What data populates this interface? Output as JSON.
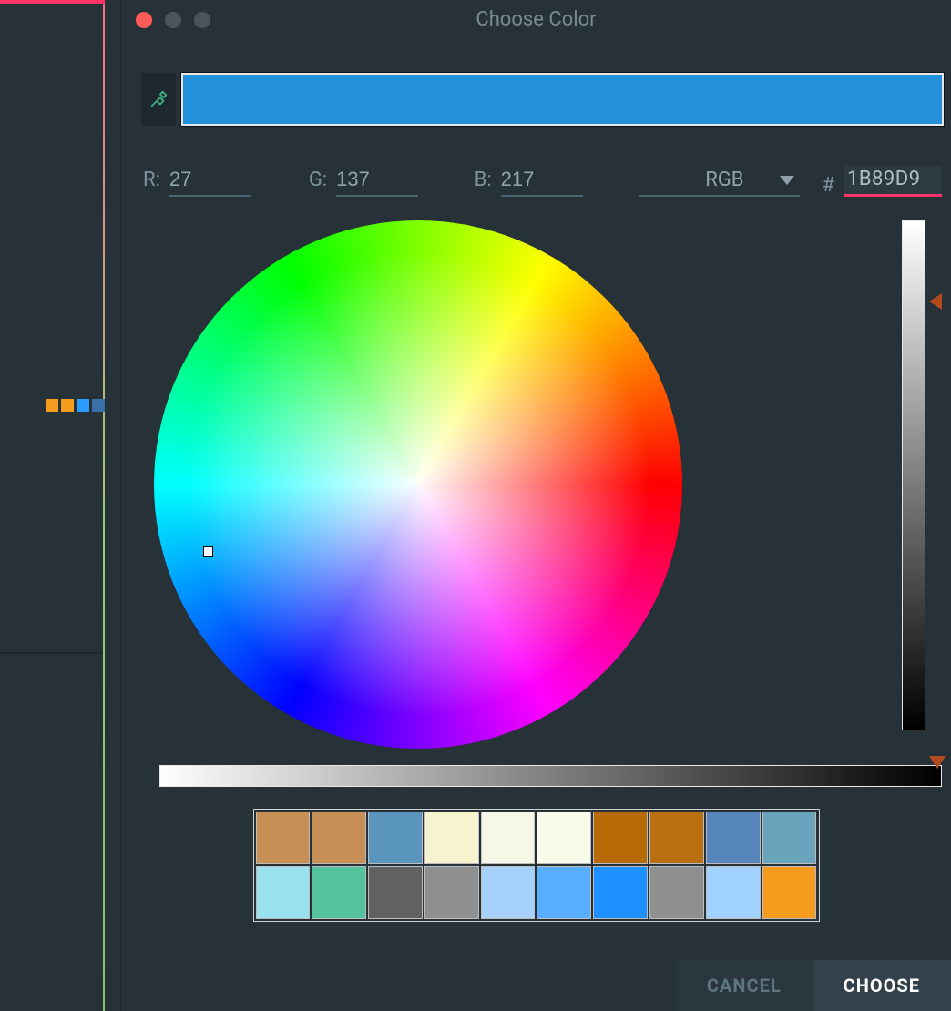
{
  "dialog": {
    "title": "Choose Color",
    "preview_color": "#2491dd",
    "channels": {
      "r_label": "R:",
      "r_value": "27",
      "g_label": "G:",
      "g_value": "137",
      "b_label": "B:",
      "b_value": "217"
    },
    "mode": "RGB",
    "hash": "#",
    "hex": "1B89D9",
    "value_slider_position": 0.14,
    "lightness_slider_position": 1.0,
    "palette": [
      "#c58f55",
      "#c58f55",
      "#5a95bd",
      "#f7f3cf",
      "#f6f7e6",
      "#f9fceb",
      "#b86a06",
      "#bb700f",
      "#5686bc",
      "#69a4bd",
      "#9ae1ef",
      "#55c29e",
      "#616161",
      "#8f8f8f",
      "#a6d1fb",
      "#57aeff",
      "#1f90ff",
      "#8f8f8f",
      "#a1d1ff",
      "#f59b1e"
    ],
    "buttons": {
      "cancel": "CANCEL",
      "choose": "CHOOSE"
    }
  },
  "left_strip": {
    "dots": [
      "#f59b1e",
      "#f59b1e",
      "#2c9dff",
      "#3a6fa8"
    ]
  }
}
